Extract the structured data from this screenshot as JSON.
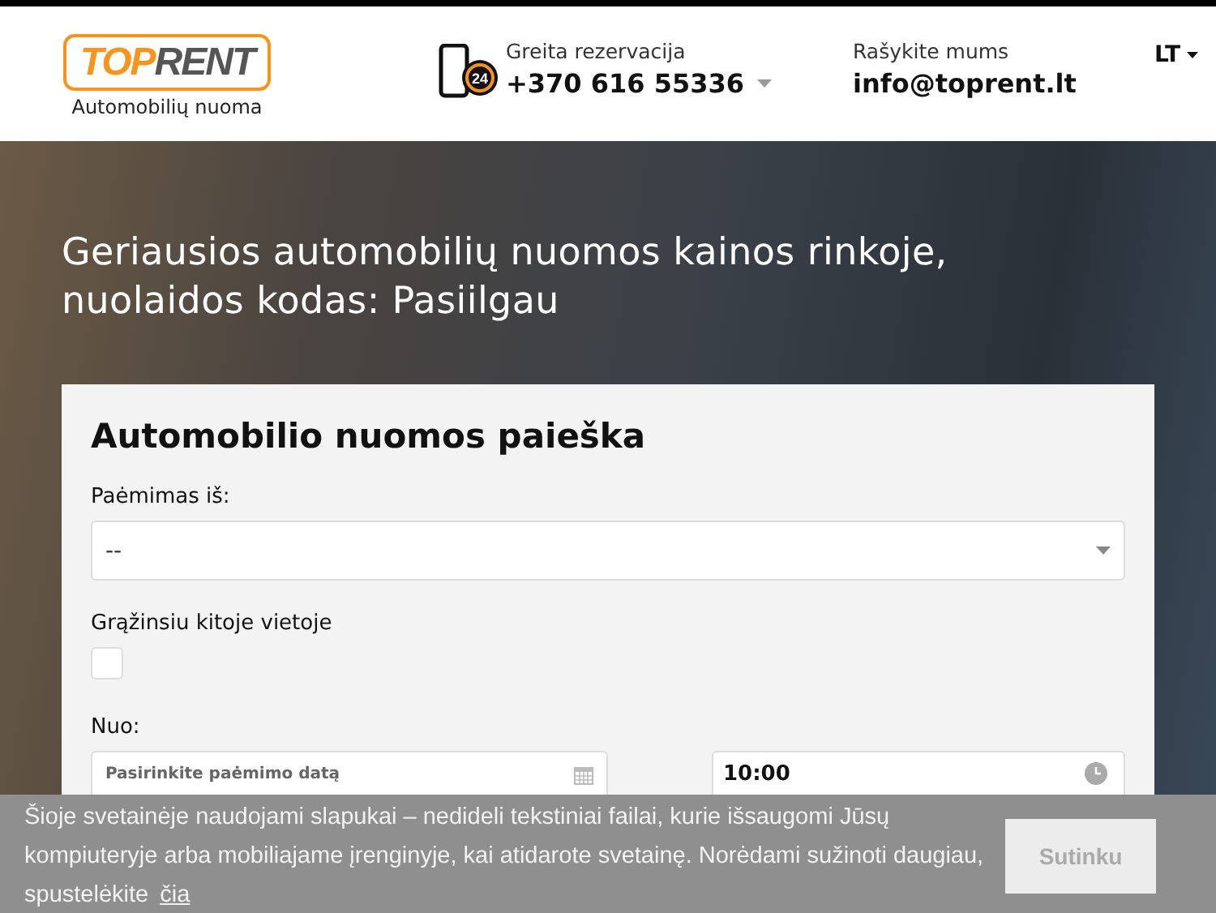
{
  "header": {
    "logo": {
      "part1": "TOP",
      "part2": "RENT",
      "tagline": "Automobilių nuoma"
    },
    "phone": {
      "label": "Greita rezervacija",
      "number": "+370 616 55336",
      "icon_text": "24"
    },
    "email": {
      "label": "Rašykite mums",
      "address": "info@toprent.lt"
    },
    "language": "LT"
  },
  "hero": {
    "headline": "Geriausios automobilių nuomos kainos rinkoje, nuolaidos kodas: Pasiilgau"
  },
  "search_form": {
    "title": "Automobilio nuomos paieška",
    "pickup": {
      "label": "Paėmimas iš:",
      "value": "--"
    },
    "return_elsewhere": {
      "label": "Grąžinsiu kitoje vietoje",
      "checked": false
    },
    "from": {
      "label": "Nuo:",
      "date_placeholder": "Pasirinkite paėmimo datą",
      "time": "10:00"
    }
  },
  "cookie_banner": {
    "text": "Šioje svetainėje naudojami slapukai – nedideli tekstiniai failai, kurie išsaugomi Jūsų kompiuteryje arba mobiliajame įrenginyje, kai atidarote svetainę. Norėdami sužinoti daugiau, spustelėkite",
    "link": "čia",
    "button": "Sutinku"
  }
}
